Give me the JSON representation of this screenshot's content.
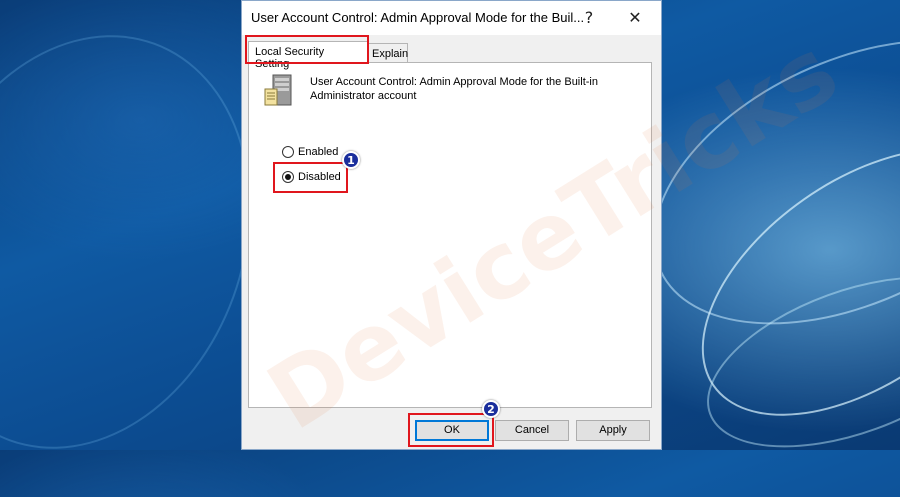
{
  "dialog": {
    "title": "User Account Control: Admin Approval Mode for the Buil...",
    "help_button": "?",
    "close_button": "✕",
    "tabs": [
      {
        "label": "Local Security Setting",
        "active": true
      },
      {
        "label": "Explain",
        "active": false
      }
    ],
    "policy": {
      "icon": "server-policy-icon",
      "description": "User Account Control: Admin Approval Mode for the Built-in Administrator account"
    },
    "options": [
      {
        "label": "Enabled",
        "selected": false
      },
      {
        "label": "Disabled",
        "selected": true
      }
    ],
    "buttons": {
      "ok": "OK",
      "cancel": "Cancel",
      "apply": "Apply"
    }
  },
  "annotations": {
    "step1": "1",
    "step2": "2",
    "highlight_color": "#e0161d",
    "badge_color": "#1a2e9c"
  },
  "watermark": "DeviceTricks"
}
